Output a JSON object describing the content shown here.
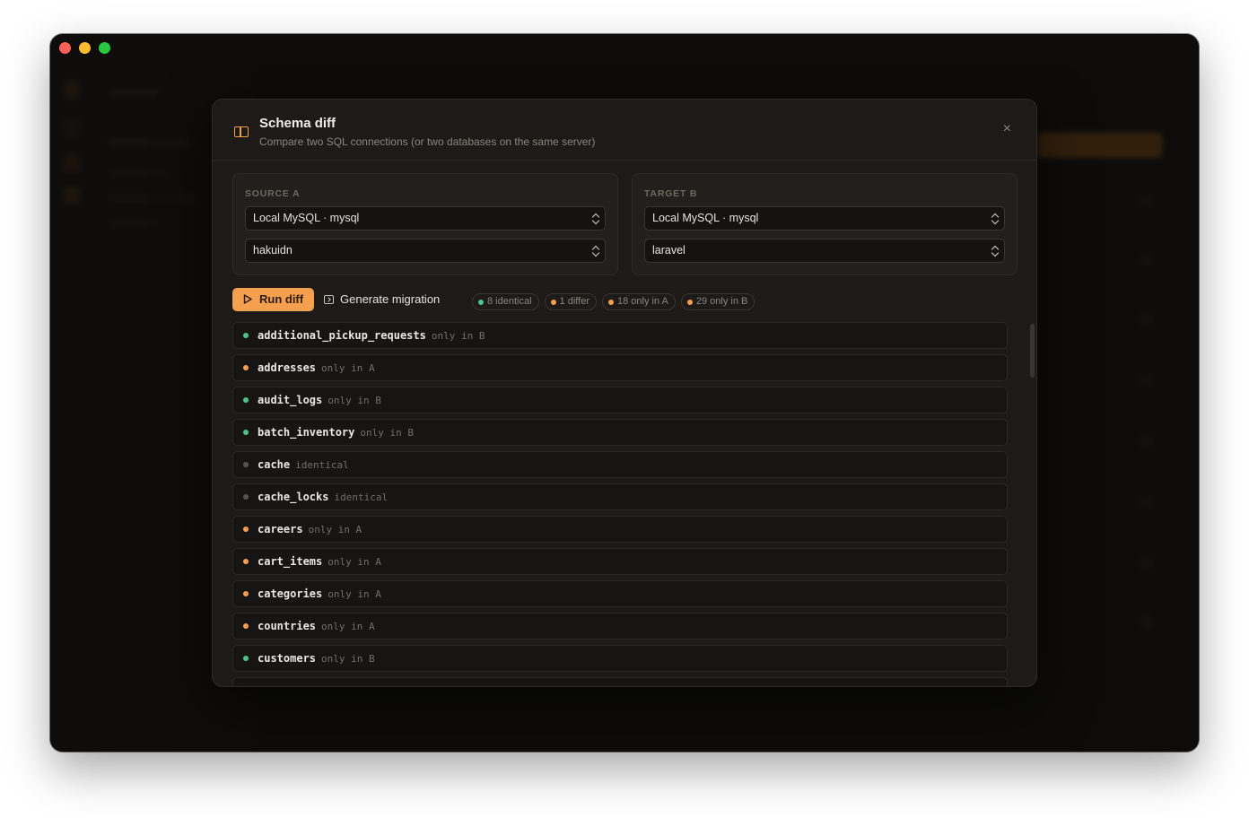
{
  "modal": {
    "title": "Schema diff",
    "subtitle": "Compare two SQL connections (or two databases on the same server)",
    "close_label": "×"
  },
  "source": {
    "label": "SOURCE A",
    "connection": "Local MySQL · mysql",
    "database": "hakuidn"
  },
  "target": {
    "label": "TARGET B",
    "connection": "Local MySQL · mysql",
    "database": "laravel"
  },
  "toolbar": {
    "run_label": "Run diff",
    "generate_label": "Generate migration"
  },
  "summary": {
    "identical": "8 identical",
    "differ": "1 differ",
    "only_a": "18 only in A",
    "only_b": "29 only in B"
  },
  "tables": [
    {
      "name": "additional_pickup_requests",
      "status": "only in B",
      "color": "green"
    },
    {
      "name": "addresses",
      "status": "only in A",
      "color": "orange"
    },
    {
      "name": "audit_logs",
      "status": "only in B",
      "color": "green"
    },
    {
      "name": "batch_inventory",
      "status": "only in B",
      "color": "green"
    },
    {
      "name": "cache",
      "status": "identical",
      "color": "grey"
    },
    {
      "name": "cache_locks",
      "status": "identical",
      "color": "grey"
    },
    {
      "name": "careers",
      "status": "only in A",
      "color": "orange"
    },
    {
      "name": "cart_items",
      "status": "only in A",
      "color": "orange"
    },
    {
      "name": "categories",
      "status": "only in A",
      "color": "orange"
    },
    {
      "name": "countries",
      "status": "only in A",
      "color": "orange"
    },
    {
      "name": "customers",
      "status": "only in B",
      "color": "green"
    }
  ],
  "colors": {
    "accent": "#f5a04e",
    "green": "#4cc38a",
    "grey": "#5a544f"
  }
}
